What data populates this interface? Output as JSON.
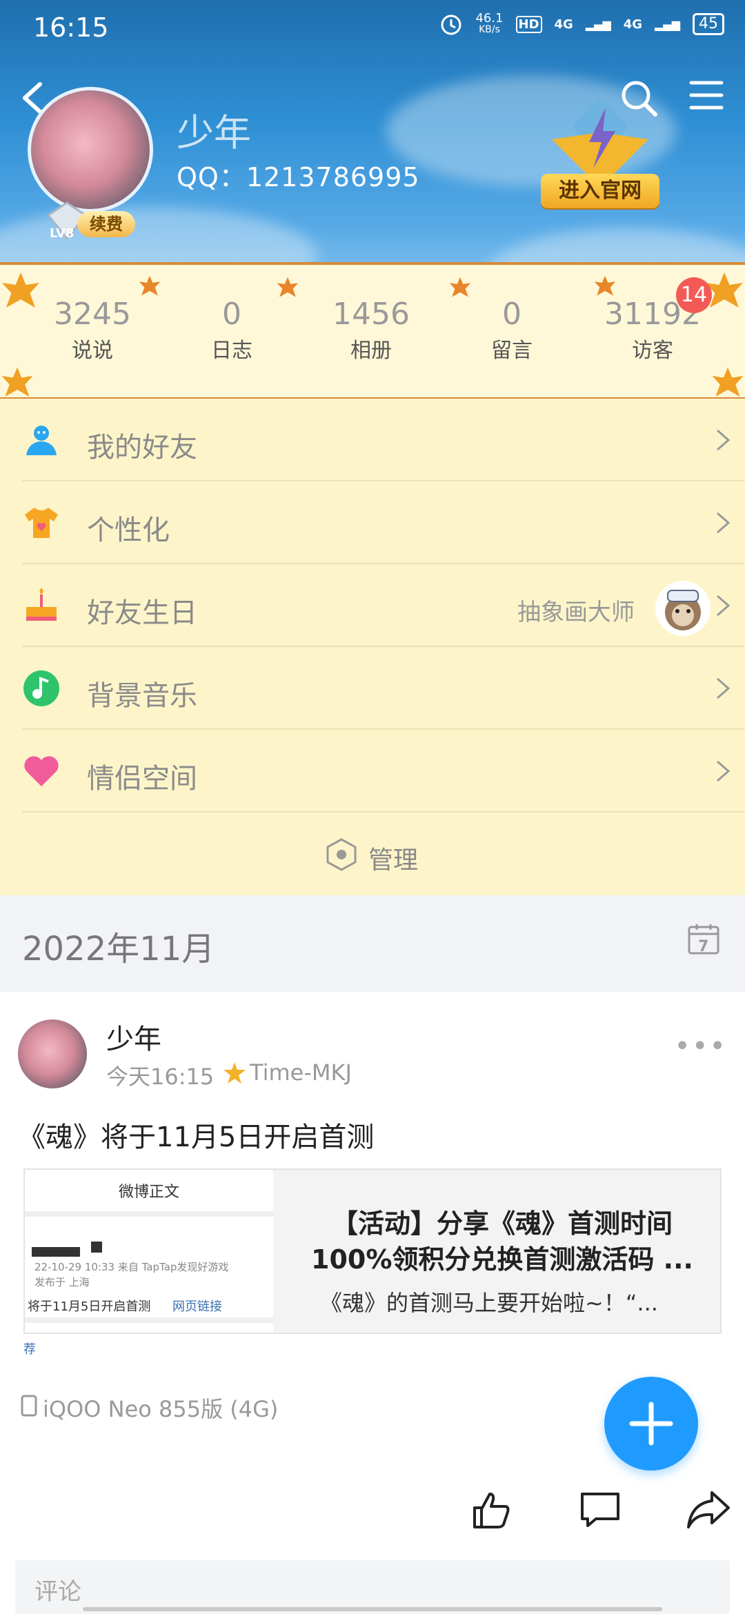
{
  "status_bar": {
    "time": "16:15",
    "network_speed": "46.1",
    "speed_unit": "KB/s",
    "battery": "45",
    "signal1": "4G",
    "signal2": "4G",
    "hd": "HD"
  },
  "profile": {
    "name": "少年",
    "qq": "QQ：1213786995",
    "level": "LV8",
    "renew_label": "续费",
    "official_label": "进入官网"
  },
  "stats": [
    {
      "value": "3245",
      "label": "说说"
    },
    {
      "value": "0",
      "label": "日志"
    },
    {
      "value": "1456",
      "label": "相册"
    },
    {
      "value": "0",
      "label": "留言"
    },
    {
      "value": "31192",
      "label": "访客"
    }
  ],
  "visitor_badge": "14",
  "menu": [
    {
      "label": "我的好友",
      "icon": "person-icon"
    },
    {
      "label": "个性化",
      "icon": "tshirt-icon"
    },
    {
      "label": "好友生日",
      "icon": "cake-icon",
      "extra": "抽象画大师"
    },
    {
      "label": "背景音乐",
      "icon": "music-icon"
    },
    {
      "label": "情侣空间",
      "icon": "heart-icon"
    }
  ],
  "manage_label": "管理",
  "month_label": "2022年11月",
  "calendar_day": "7",
  "post": {
    "author": "少年",
    "time": "今天16:15",
    "tag": "Time-MKJ",
    "text": "《魂》将于11月5日开启首测",
    "card": {
      "thumb_title": "微博正文",
      "thumb_meta1": "22-10-29 10:33  来自 TapTap发现好游戏",
      "thumb_meta2": "发布于 上海",
      "thumb_body": "将于11月5日开启首测",
      "thumb_link": "网页链接",
      "thumb_rec": "荐",
      "title_line1": "【活动】分享《魂》首测时间",
      "title_line2": "100%领积分兑换首测激活码 ...",
      "desc": "《魂》的首测马上要开始啦~！“..."
    },
    "device": "iQOO Neo 855版 (4G)",
    "comment_placeholder": "评论"
  }
}
